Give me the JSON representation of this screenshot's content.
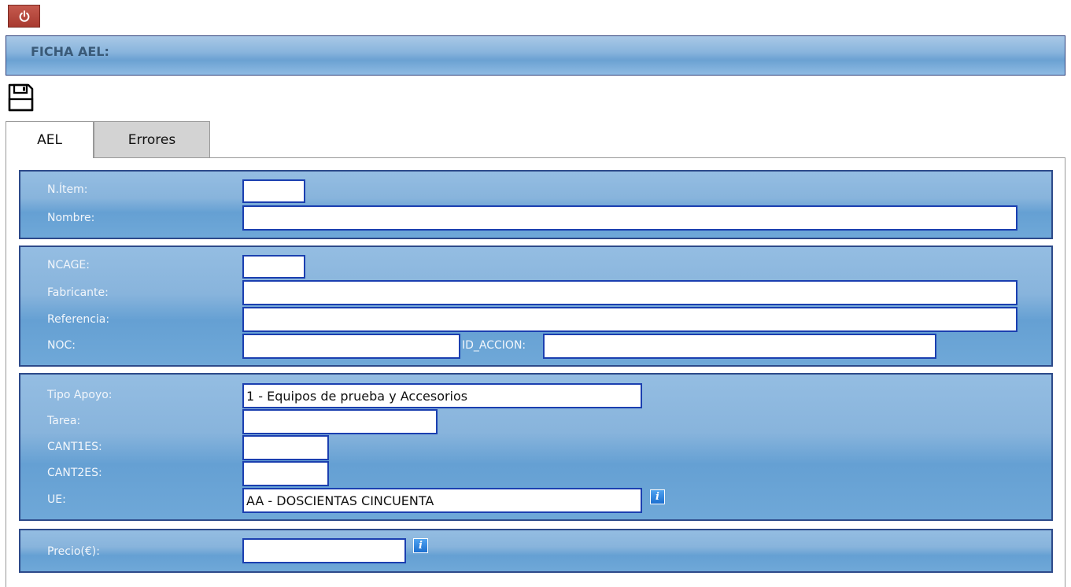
{
  "header": {
    "title": "FICHA AEL:"
  },
  "icons": {
    "power": "power-icon",
    "save": "floppy-disk-icon",
    "info": "info-icon"
  },
  "tabs": [
    {
      "label": "AEL",
      "active": true
    },
    {
      "label": "Errores",
      "active": false
    }
  ],
  "section_item": {
    "nitem_label": "N.Ítem:",
    "nitem_value": "",
    "nombre_label": "Nombre:",
    "nombre_value": ""
  },
  "section_fabricante": {
    "ncage_label": "NCAGE:",
    "ncage_value": "",
    "fabricante_label": "Fabricante:",
    "fabricante_value": "",
    "referencia_label": "Referencia:",
    "referencia_value": "",
    "noc_label": "NOC:",
    "noc_value": "",
    "id_accion_label": "ID_ACCION:",
    "id_accion_value": ""
  },
  "section_apoyo": {
    "tipo_apoyo_label": "Tipo Apoyo:",
    "tipo_apoyo_value": "1 - Equipos de prueba y Accesorios",
    "tarea_label": "Tarea:",
    "tarea_value": "",
    "cant1es_label": "CANT1ES:",
    "cant1es_value": "",
    "cant2es_label": "CANT2ES:",
    "cant2es_value": "",
    "ue_label": "UE:",
    "ue_value": "AA - DOSCIENTAS CINCUENTA"
  },
  "section_precio": {
    "precio_label": "Precio(€):",
    "precio_value": ""
  },
  "colors": {
    "accent_blue": "#6ba1d2",
    "border_blue": "#1b3fb0",
    "power_red": "#b5433a"
  }
}
